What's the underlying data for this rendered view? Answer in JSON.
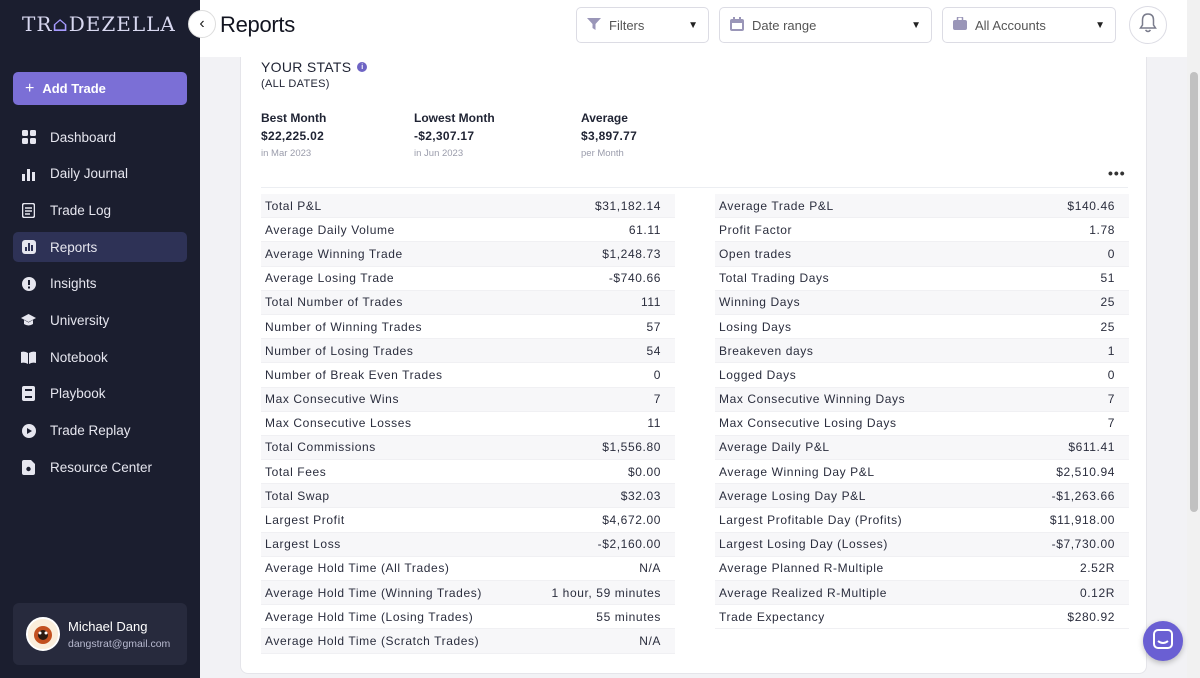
{
  "brand": {
    "logo_text_a": "TR",
    "logo_text_hl": "⌂",
    "logo_text_b": "DEZELLA"
  },
  "sidebar": {
    "add_trade_label": "Add Trade",
    "items": [
      {
        "label": "Dashboard",
        "icon": "dashboard-icon"
      },
      {
        "label": "Daily Journal",
        "icon": "bar-chart-icon"
      },
      {
        "label": "Trade Log",
        "icon": "document-icon"
      },
      {
        "label": "Reports",
        "icon": "reports-icon",
        "active": true
      },
      {
        "label": "Insights",
        "icon": "alert-icon"
      },
      {
        "label": "University",
        "icon": "graduation-cap-icon"
      },
      {
        "label": "Notebook",
        "icon": "notebook-icon"
      },
      {
        "label": "Playbook",
        "icon": "playbook-icon"
      },
      {
        "label": "Trade Replay",
        "icon": "play-icon"
      },
      {
        "label": "Resource Center",
        "icon": "resource-icon"
      }
    ],
    "user": {
      "name": "Michael Dang",
      "email": "dangstrat@gmail.com"
    }
  },
  "header": {
    "title": "Reports",
    "filters_label": "Filters",
    "date_range_label": "Date range",
    "accounts_label": "All Accounts"
  },
  "stats": {
    "title": "YOUR STATS",
    "subtitle": "(ALL DATES)",
    "best_month": {
      "label": "Best Month",
      "value": "$22,225.02",
      "note": "in Mar 2023"
    },
    "lowest_month": {
      "label": "Lowest Month",
      "value": "-$2,307.17",
      "note": "in Jun 2023"
    },
    "average": {
      "label": "Average",
      "value": "$3,897.77",
      "note": "per Month"
    },
    "left_rows": [
      {
        "label": "Total P&L",
        "value": "$31,182.14"
      },
      {
        "label": "Average Daily Volume",
        "value": "61.11"
      },
      {
        "label": "Average Winning Trade",
        "value": "$1,248.73"
      },
      {
        "label": "Average Losing Trade",
        "value": "-$740.66"
      },
      {
        "label": "Total Number of Trades",
        "value": "111"
      },
      {
        "label": "Number of Winning Trades",
        "value": "57"
      },
      {
        "label": "Number of Losing Trades",
        "value": "54"
      },
      {
        "label": "Number of Break Even Trades",
        "value": "0"
      },
      {
        "label": "Max Consecutive Wins",
        "value": "7"
      },
      {
        "label": "Max Consecutive Losses",
        "value": "11"
      },
      {
        "label": "Total Commissions",
        "value": "$1,556.80"
      },
      {
        "label": "Total Fees",
        "value": "$0.00"
      },
      {
        "label": "Total Swap",
        "value": "$32.03"
      },
      {
        "label": "Largest Profit",
        "value": "$4,672.00"
      },
      {
        "label": "Largest Loss",
        "value": "-$2,160.00"
      },
      {
        "label": "Average Hold Time (All Trades)",
        "value": "N/A"
      },
      {
        "label": "Average Hold Time (Winning Trades)",
        "value": "1 hour, 59 minutes"
      },
      {
        "label": "Average Hold Time (Losing Trades)",
        "value": "55 minutes"
      },
      {
        "label": "Average Hold Time (Scratch Trades)",
        "value": "N/A"
      }
    ],
    "right_rows": [
      {
        "label": "Average Trade P&L",
        "value": "$140.46"
      },
      {
        "label": "Profit Factor",
        "value": "1.78"
      },
      {
        "label": "Open trades",
        "value": "0"
      },
      {
        "label": "Total Trading Days",
        "value": "51"
      },
      {
        "label": "Winning Days",
        "value": "25"
      },
      {
        "label": "Losing Days",
        "value": "25"
      },
      {
        "label": "Breakeven days",
        "value": "1"
      },
      {
        "label": "Logged Days",
        "value": "0"
      },
      {
        "label": "Max Consecutive Winning Days",
        "value": "7"
      },
      {
        "label": "Max Consecutive Losing Days",
        "value": "7"
      },
      {
        "label": "Average Daily P&L",
        "value": "$611.41"
      },
      {
        "label": "Average Winning Day P&L",
        "value": "$2,510.94"
      },
      {
        "label": "Average Losing Day P&L",
        "value": "-$1,263.66"
      },
      {
        "label": "Largest Profitable Day (Profits)",
        "value": "$11,918.00"
      },
      {
        "label": "Largest Losing Day (Losses)",
        "value": "-$7,730.00"
      },
      {
        "label": "Average Planned R-Multiple",
        "value": "2.52R"
      },
      {
        "label": "Average Realized R-Multiple",
        "value": "0.12R"
      },
      {
        "label": "Trade Expectancy",
        "value": "$280.92"
      }
    ]
  },
  "colors": {
    "sidebar": "#1b1e2f",
    "accent": "#7b6fd6",
    "active_nav": "#2e3256"
  }
}
